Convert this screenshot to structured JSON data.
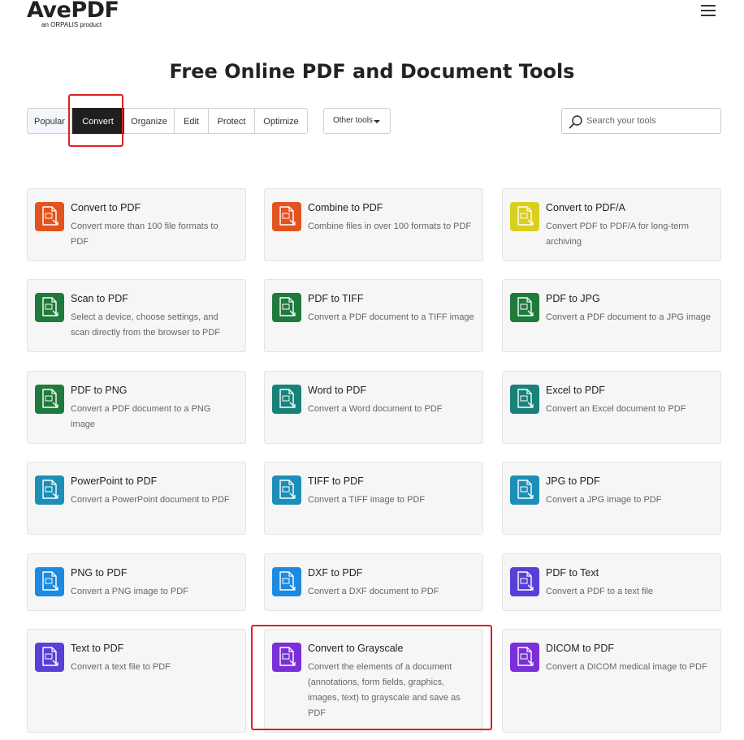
{
  "header": {
    "logo_text": "AvePDF",
    "logo_subtitle": "an ORPALIS product",
    "menu_icon": "hamburger-icon"
  },
  "page_title": "Free Online PDF and Document Tools",
  "tabs": [
    {
      "label": "Popular",
      "selected": false
    },
    {
      "label": "Convert",
      "selected": true
    },
    {
      "label": "Organize",
      "selected": false
    },
    {
      "label": "Edit",
      "selected": false
    },
    {
      "label": "Protect",
      "selected": false
    },
    {
      "label": "Optimize",
      "selected": false
    }
  ],
  "other_tools_label": "Other tools",
  "search": {
    "placeholder": "Search your tools",
    "icon": "search-icon"
  },
  "colors": {
    "orange": "#e2531f",
    "yellow": "#d9cf1e",
    "green": "#1f7a3c",
    "teal": "#18827a",
    "cyan": "#1c8fb8",
    "blue": "#1d89e0",
    "violet": "#5a3fd6",
    "purple": "#7a2fd8",
    "highlight": "#e02020",
    "active_tab": "#1f1f1f"
  },
  "tools": [
    {
      "title": "Convert to PDF",
      "desc": "Convert more than 100 file formats to PDF",
      "icon": "convert-arrows-icon",
      "color": "#e2531f"
    },
    {
      "title": "Combine to PDF",
      "desc": "Combine files in over 100 formats to PDF",
      "icon": "stack-merge-icon",
      "color": "#e2531f"
    },
    {
      "title": "Convert to PDF/A",
      "desc": "Convert PDF to PDF/A for long-term archiving",
      "icon": "archive-document-icon",
      "color": "#d9cf1e"
    },
    {
      "title": "Scan to PDF",
      "desc": "Select a device, choose settings, and scan directly from the browser to PDF",
      "icon": "scanner-icon",
      "color": "#1f7a3c"
    },
    {
      "title": "PDF to TIFF",
      "desc": "Convert a PDF document to a TIFF image",
      "icon": "document-to-tiff-icon",
      "color": "#1f7a3c"
    },
    {
      "title": "PDF to JPG",
      "desc": "Convert a PDF document to a JPG image",
      "icon": "document-to-jpg-icon",
      "color": "#1f7a3c"
    },
    {
      "title": "PDF to PNG",
      "desc": "Convert a PDF document to a PNG image",
      "icon": "document-to-png-icon",
      "color": "#1f7a3c"
    },
    {
      "title": "Word to PDF",
      "desc": "Convert a Word document to PDF",
      "icon": "word-document-icon",
      "color": "#18827a"
    },
    {
      "title": "Excel to PDF",
      "desc": "Convert an Excel document to PDF",
      "icon": "excel-document-icon",
      "color": "#18827a"
    },
    {
      "title": "PowerPoint to PDF",
      "desc": "Convert a PowerPoint document to PDF",
      "icon": "powerpoint-document-icon",
      "color": "#1c8fb8"
    },
    {
      "title": "TIFF to PDF",
      "desc": "Convert a TIFF image to PDF",
      "icon": "tiff-image-icon",
      "color": "#1c8fb8"
    },
    {
      "title": "JPG to PDF",
      "desc": "Convert a JPG image to PDF",
      "icon": "jpg-image-icon",
      "color": "#1c8fb8"
    },
    {
      "title": "PNG to PDF",
      "desc": "Convert a PNG image to PDF",
      "icon": "png-image-icon",
      "color": "#1d89e0"
    },
    {
      "title": "DXF to PDF",
      "desc": "Convert a DXF document to PDF",
      "icon": "dxf-document-icon",
      "color": "#1d89e0"
    },
    {
      "title": "PDF to Text",
      "desc": "Convert a PDF to a text file",
      "icon": "document-to-text-icon",
      "color": "#5a3fd6"
    },
    {
      "title": "Text to PDF",
      "desc": "Convert a text file to PDF",
      "icon": "text-file-icon",
      "color": "#5a3fd6"
    },
    {
      "title": "Convert to Grayscale",
      "desc": "Convert the elements of a document (annotations, form fields, graphics, images, text) to grayscale and save as PDF",
      "icon": "grayscale-document-icon",
      "color": "#7a2fd8"
    },
    {
      "title": "DICOM to PDF",
      "desc": "Convert a DICOM medical image to PDF",
      "icon": "dicom-image-icon",
      "color": "#7a2fd8"
    }
  ]
}
